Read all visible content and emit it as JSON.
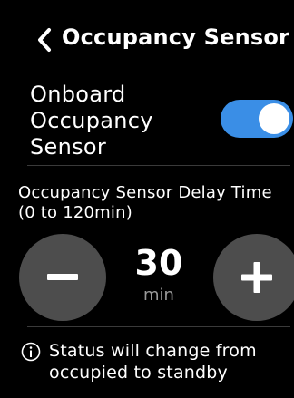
{
  "header": {
    "title": "Occupancy Sensor",
    "back_icon": "chevron-left-icon"
  },
  "onboard_sensor": {
    "label": "Onboard\nOccupancy\nSensor",
    "enabled": true,
    "accent_color": "#3a8ee6"
  },
  "delay": {
    "label": "Occupancy Sensor Delay Time (0 to 120min)",
    "value": "30",
    "unit": "min",
    "decrement_icon": "minus-icon",
    "increment_icon": "plus-icon"
  },
  "status": {
    "icon": "info-icon",
    "message": "Status will change from\noccupied to standby"
  }
}
